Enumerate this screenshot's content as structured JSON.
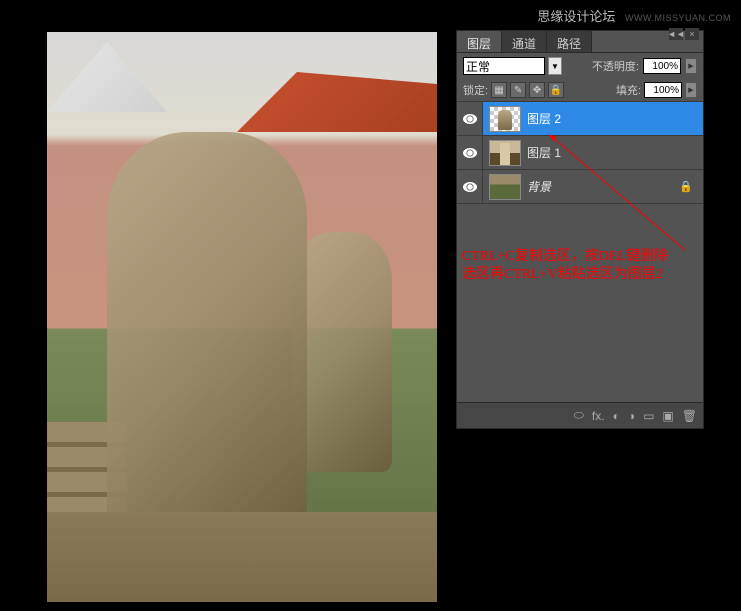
{
  "watermark": {
    "main": "思缘设计论坛",
    "sub": "WWW.MISSYUAN.COM"
  },
  "panel": {
    "tabs": [
      "图层",
      "通道",
      "路径"
    ],
    "active_tab": 0,
    "blend_mode": "正常",
    "opacity_label": "不透明度:",
    "opacity_value": "100%",
    "lock_label": "锁定:",
    "fill_label": "填充:",
    "fill_value": "100%",
    "layers": [
      {
        "name": "图层 2",
        "selected": true,
        "thumb": "checker",
        "locked": false
      },
      {
        "name": "图层 1",
        "selected": false,
        "thumb": "img1",
        "locked": false
      },
      {
        "name": "背景",
        "selected": false,
        "thumb": "bg",
        "locked": true,
        "italic": true
      }
    ]
  },
  "annotation": {
    "line1": "CTRL+C复制选区，按DEL键删除",
    "line2": "选区再CTRL+V粘贴选区为图层2"
  }
}
